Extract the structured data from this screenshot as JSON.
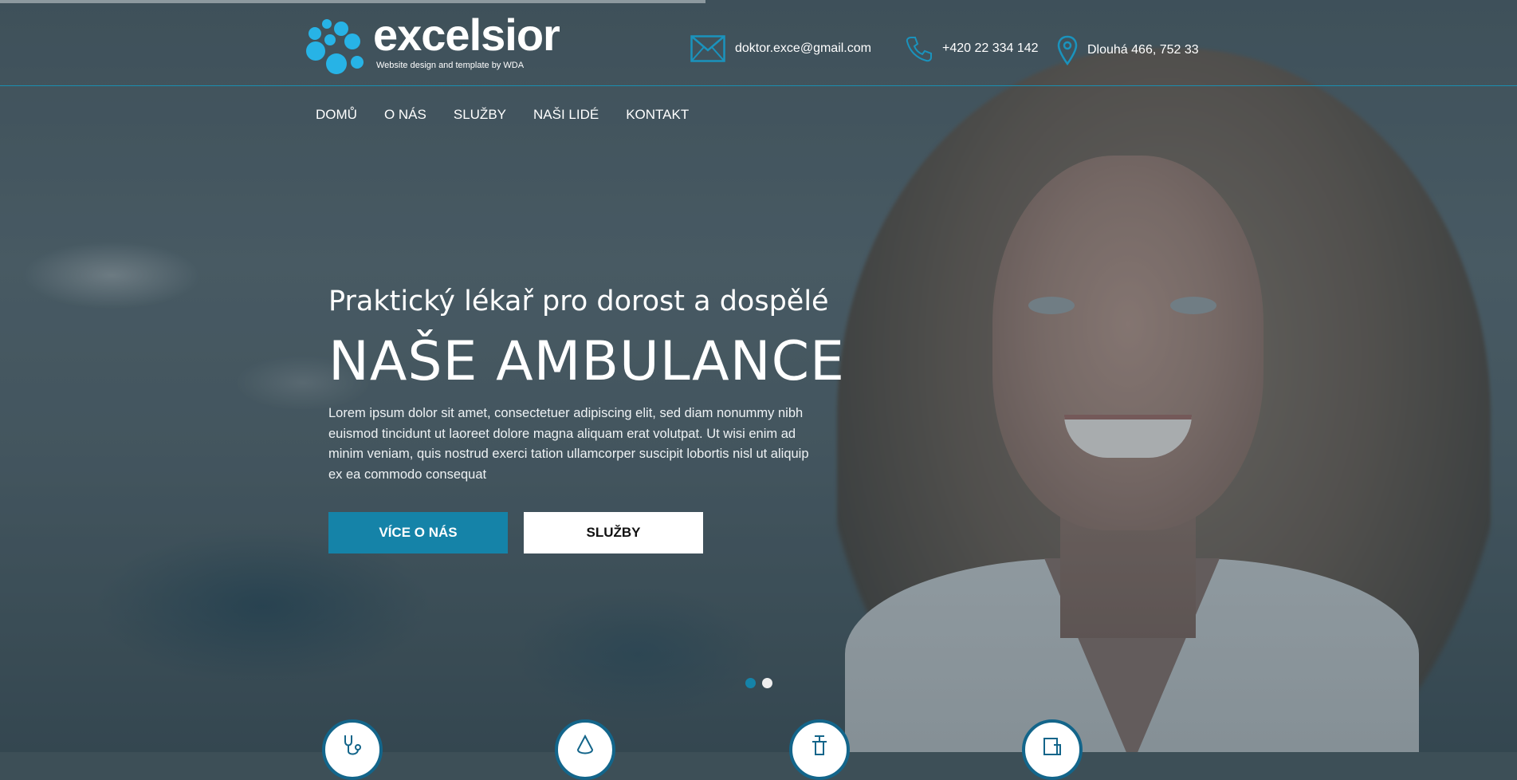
{
  "header": {
    "logo_name": "excelsior",
    "logo_tagline": "Website design and template by WDA",
    "email": "doktor.exce@gmail.com",
    "phone": "+420 22 334 142",
    "address": "Dlouhá 466, 752 33",
    "accent_color": "#1583a8"
  },
  "nav": {
    "items": [
      "DOMŮ",
      "O NÁS",
      "SLUŽBY",
      "NAŠI LIDÉ",
      "KONTAKT"
    ]
  },
  "hero": {
    "subtitle": "Praktický lékař pro dorost a dospělé",
    "title": "NAŠE AMBULANCE",
    "text": "Lorem ipsum dolor sit amet, consectetuer adipiscing elit, sed diam nonummy nibh euismod tincidunt ut laoreet dolore magna aliquam erat volutpat. Ut wisi enim ad minim veniam, quis nostrud exerci tation ullamcorper suscipit lobortis nisl ut aliquip ex ea commodo consequat",
    "primary_button": "VÍCE O NÁS",
    "secondary_button": "SLUŽBY"
  },
  "slider": {
    "slide_count": 2,
    "active_slide": 1
  },
  "services": {
    "icons": [
      "stethoscope-icon",
      "drop-icon",
      "syringe-icon",
      "medical-record-icon"
    ]
  }
}
